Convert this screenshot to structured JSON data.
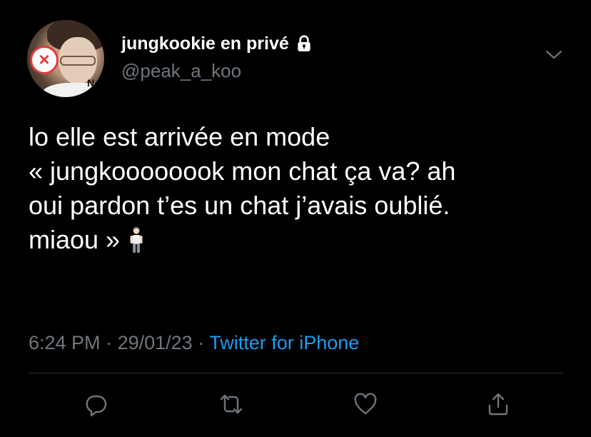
{
  "author": {
    "display_name": "jungkookie en privé",
    "handle": "@peak_a_koo",
    "protected_icon": "lock-icon",
    "avatar_sign_text": "N"
  },
  "tweet": {
    "text": "lo elle est arrivée en mode\n« jungkoooooook mon chat ça va? ah\noui pardon t’es un chat j’avais oublié.\nmiaou »",
    "emoji": "standing-person-emoji"
  },
  "meta": {
    "time": "6:24 PM",
    "separator": "·",
    "date": "29/01/23",
    "source": "Twitter for iPhone"
  },
  "actions": {
    "reply_icon": "reply-icon",
    "retweet_icon": "retweet-icon",
    "like_icon": "heart-icon",
    "share_icon": "share-icon",
    "menu_icon": "chevron-down-icon"
  },
  "colors": {
    "background": "#000000",
    "text": "#ffffff",
    "secondary": "#6e767d",
    "accent": "#1d9bf0",
    "divider": "#2f3336"
  }
}
